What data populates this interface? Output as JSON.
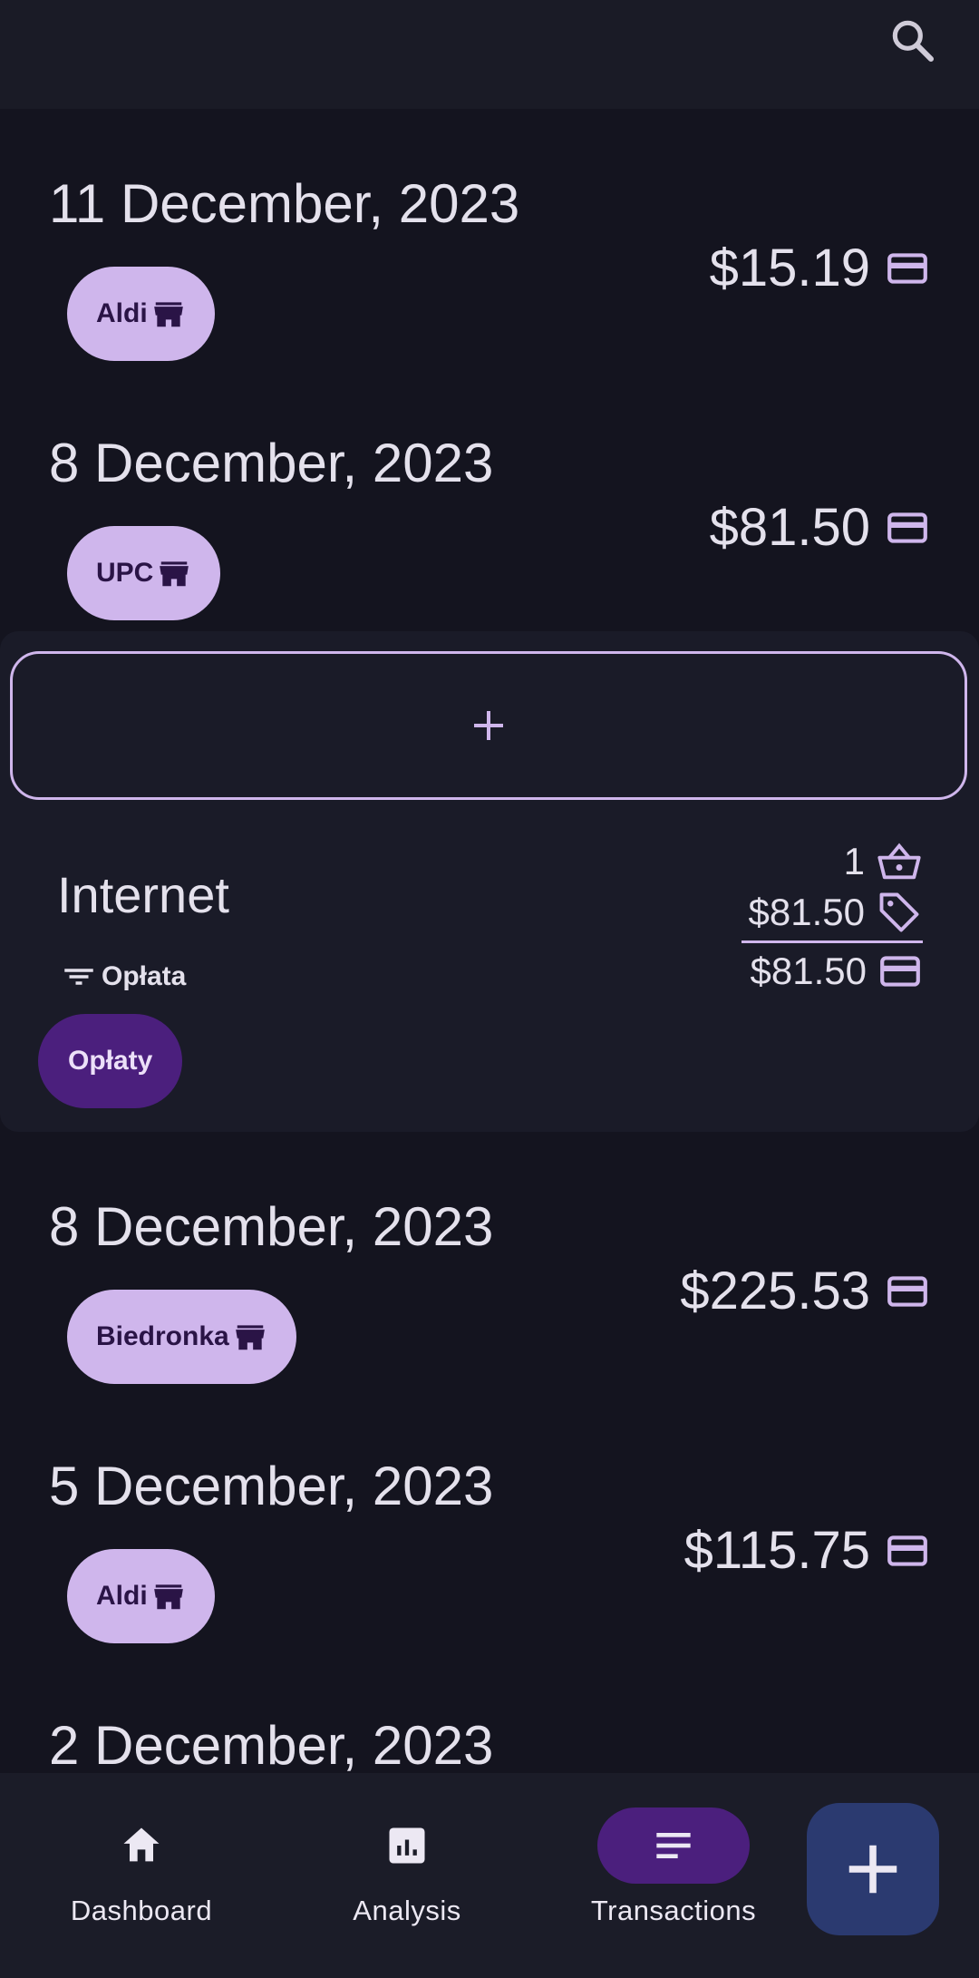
{
  "header": {
    "search_icon": "search-icon"
  },
  "transactions_before": [
    {
      "date": "11 December, 2023",
      "shop": "Aldi",
      "amount": "$15.19"
    },
    {
      "date": "8 December, 2023",
      "shop": "UPC",
      "amount": "$81.50"
    }
  ],
  "expanded_item": {
    "add_icon": "plus-icon",
    "name": "Internet",
    "category": "Opłata",
    "tag": "Opłaty",
    "quantity": "1",
    "price": "$81.50",
    "total": "$81.50"
  },
  "transactions_after": [
    {
      "date": "8 December, 2023",
      "shop": "Biedronka",
      "amount": "$225.53"
    },
    {
      "date": "5 December, 2023",
      "shop": "Aldi",
      "amount": "$115.75"
    },
    {
      "date": "2 December, 2023"
    }
  ],
  "nav": {
    "items": [
      {
        "label": "Dashboard",
        "icon": "home-icon"
      },
      {
        "label": "Analysis",
        "icon": "chart-icon"
      },
      {
        "label": "Transactions",
        "icon": "list-icon",
        "active": true
      }
    ],
    "fab_icon": "plus-icon"
  },
  "colors": {
    "background": "#14141f",
    "accent": "#cfb6ec",
    "active_pill": "#4b1f7d",
    "fab": "#2b3a70"
  }
}
